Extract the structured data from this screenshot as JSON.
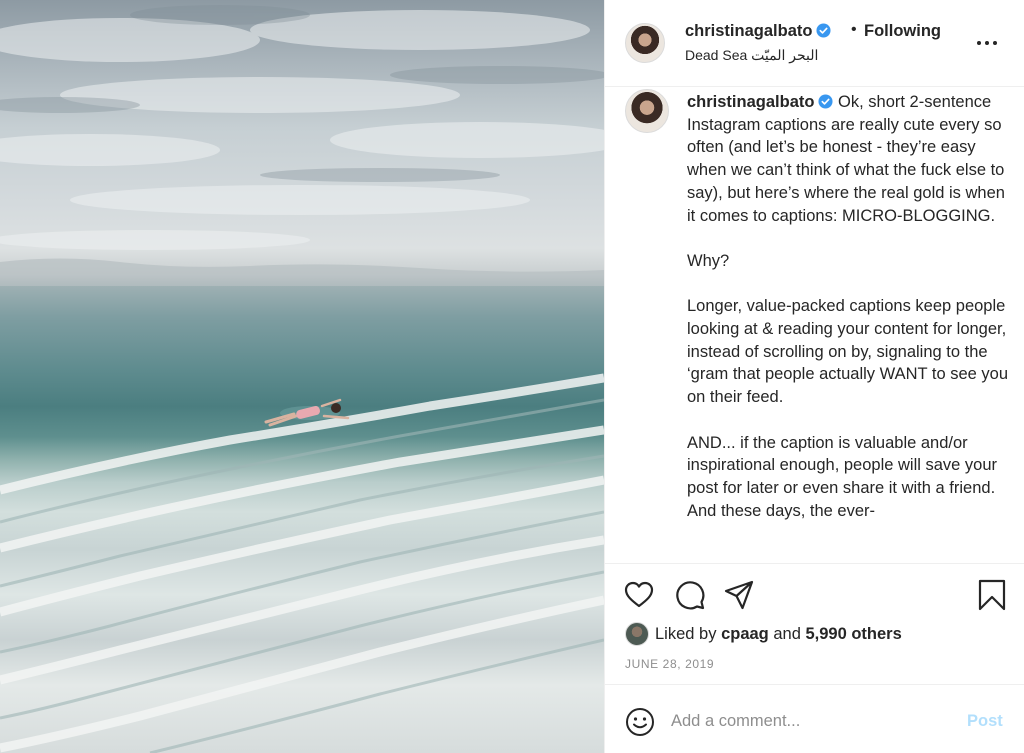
{
  "post": {
    "username": "christinagalbato",
    "follow_status": "Following",
    "location": "Dead Sea البحر الميّت",
    "caption_text": " Ok, short 2-sentence Instagram captions are really cute every so often (and let’s be honest - they’re easy when we can’t think of what the fuck else to say), but here’s where the real gold is when it comes to captions: MICRO-BLOGGING.\n\nWhy?\n\nLonger, value-packed captions keep people looking at & reading your content for longer, instead of scrolling on by, signaling to the ‘gram that people actually WANT to see you on their feed.\n\nAND... if the caption is valuable and/or inspirational enough, people will save your post for later or even share it with a friend. And these days, the ever-",
    "likes": {
      "prefix": "Liked by",
      "user": "cpaag",
      "and": "and",
      "others": "5,990 others"
    },
    "date": "JUNE 28, 2019"
  },
  "comment_box": {
    "placeholder": "Add a comment...",
    "post_label": "Post"
  },
  "colors": {
    "verified_badge": "#3897f0",
    "post_button_disabled": "#b2dffc",
    "muted_text": "#8e8e8e"
  },
  "icons": [
    "verified-icon",
    "more-options-icon",
    "heart-icon",
    "comment-icon",
    "share-icon",
    "bookmark-icon",
    "emoji-icon"
  ]
}
